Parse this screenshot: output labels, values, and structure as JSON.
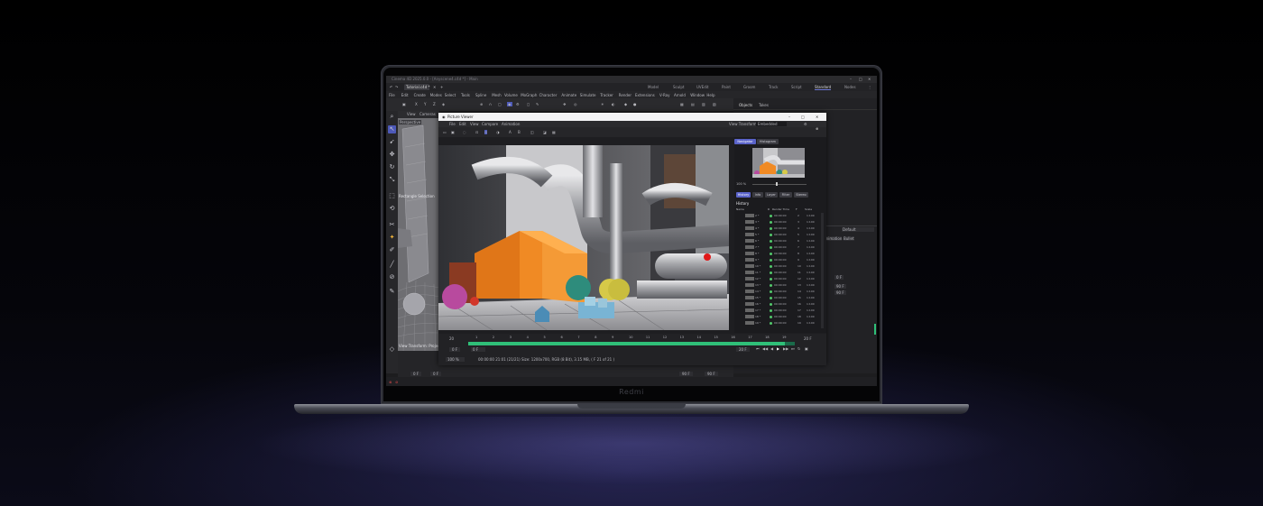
{
  "app": {
    "window_title": "Cinema 4D 2025.0.0 - [Anyscene4.c4d *] - Main",
    "doc_tab": "Tutorial.c4d *",
    "layout_tabs": [
      "Model",
      "Sculpt",
      "UVEdit",
      "Paint",
      "Groom",
      "Track",
      "Script",
      "Standard",
      "Nodes"
    ],
    "active_layout": "Standard",
    "menu": [
      "File",
      "Edit",
      "Create",
      "Modes",
      "Select",
      "Tools",
      "Spline",
      "Mesh",
      "Volume",
      "MoGraph",
      "Character",
      "Animate",
      "Simulate",
      "Tracker",
      "Render",
      "Extensions",
      "V-Ray",
      "Arnold",
      "Window",
      "Help"
    ],
    "viewport_menu": [
      "View",
      "Cameras"
    ],
    "viewport_label": "Perspective",
    "viewport_selection_label": "Rectangle Selection",
    "view_transform_label": "View Transform: Project",
    "objects_tabs": [
      "Objects",
      "Takes"
    ],
    "attr_default": "Default",
    "attr_buttons": [
      "Animation",
      "Bullet"
    ],
    "attr_values": [
      "0 F",
      "90 F",
      "90 F"
    ],
    "timeline_left": [
      "0 F",
      "0 F"
    ],
    "timeline_right": [
      "90 F",
      "90 F"
    ]
  },
  "picture_viewer": {
    "title": "Picture Viewer",
    "menu": [
      "File",
      "Edit",
      "View",
      "Compare",
      "Animation"
    ],
    "view_transform_label": "View Transform",
    "view_transform_value": "Embedded",
    "nav_tabs": [
      "Navigator",
      "Histogram"
    ],
    "active_nav_tab": "Navigator",
    "nav_zoom": "100 %",
    "info_tabs": [
      "History",
      "Info",
      "Layer",
      "Filter",
      "Stereo"
    ],
    "active_info_tab": "History",
    "history_heading": "History",
    "history_columns": [
      "Name",
      "R",
      "Render Time",
      "F",
      "Scale"
    ],
    "history_rows": [
      {
        "name": "2 *",
        "time": "00:00:00",
        "frame": "2",
        "scale": "1:100"
      },
      {
        "name": "3 *",
        "time": "00:00:00",
        "frame": "3",
        "scale": "1:100"
      },
      {
        "name": "4 *",
        "time": "00:00:00",
        "frame": "4",
        "scale": "1:100"
      },
      {
        "name": "5 *",
        "time": "00:00:00",
        "frame": "5",
        "scale": "1:100"
      },
      {
        "name": "6 *",
        "time": "00:00:00",
        "frame": "6",
        "scale": "1:100"
      },
      {
        "name": "7 *",
        "time": "00:00:00",
        "frame": "7",
        "scale": "1:100"
      },
      {
        "name": "8 *",
        "time": "00:00:00",
        "frame": "8",
        "scale": "1:100"
      },
      {
        "name": "9 *",
        "time": "00:00:00",
        "frame": "9",
        "scale": "1:100"
      },
      {
        "name": "10 *",
        "time": "00:00:00",
        "frame": "10",
        "scale": "1:100"
      },
      {
        "name": "11 *",
        "time": "00:00:00",
        "frame": "11",
        "scale": "1:100"
      },
      {
        "name": "12 *",
        "time": "00:00:00",
        "frame": "12",
        "scale": "1:100"
      },
      {
        "name": "13 *",
        "time": "00:00:00",
        "frame": "13",
        "scale": "1:100"
      },
      {
        "name": "14 *",
        "time": "00:00:00",
        "frame": "14",
        "scale": "1:100"
      },
      {
        "name": "15 *",
        "time": "00:00:00",
        "frame": "15",
        "scale": "1:100"
      },
      {
        "name": "16 *",
        "time": "00:00:00",
        "frame": "16",
        "scale": "1:100"
      },
      {
        "name": "17 *",
        "time": "00:00:00",
        "frame": "17",
        "scale": "1:100"
      },
      {
        "name": "18 *",
        "time": "00:00:00",
        "frame": "18",
        "scale": "1:100"
      },
      {
        "name": "19 *",
        "time": "00:00:00",
        "frame": "19",
        "scale": "1:100"
      }
    ],
    "frame_start": "20",
    "frame_end": "20 F",
    "ruler_ticks": [
      "1",
      "2",
      "3",
      "4",
      "5",
      "6",
      "7",
      "8",
      "9",
      "10",
      "11",
      "12",
      "13",
      "14",
      "15",
      "16",
      "17",
      "18",
      "19"
    ],
    "frame_field_left": "0 F",
    "frame_field_left2": "0 F",
    "frame_field_right": "20 F",
    "zoom": "100 %",
    "status": "00:00:00  21:01 (21/21)    Size: 1200x700, RGB (8 Bit), 3.15 MB,  ( F 21 of 21 )",
    "timeline_fill": 0.97
  },
  "laptop": {
    "brand": "Redmi"
  },
  "colors": {
    "accent": "#5a63c9",
    "play_green": "#2fbf78",
    "house_orange": "#f08a24"
  }
}
